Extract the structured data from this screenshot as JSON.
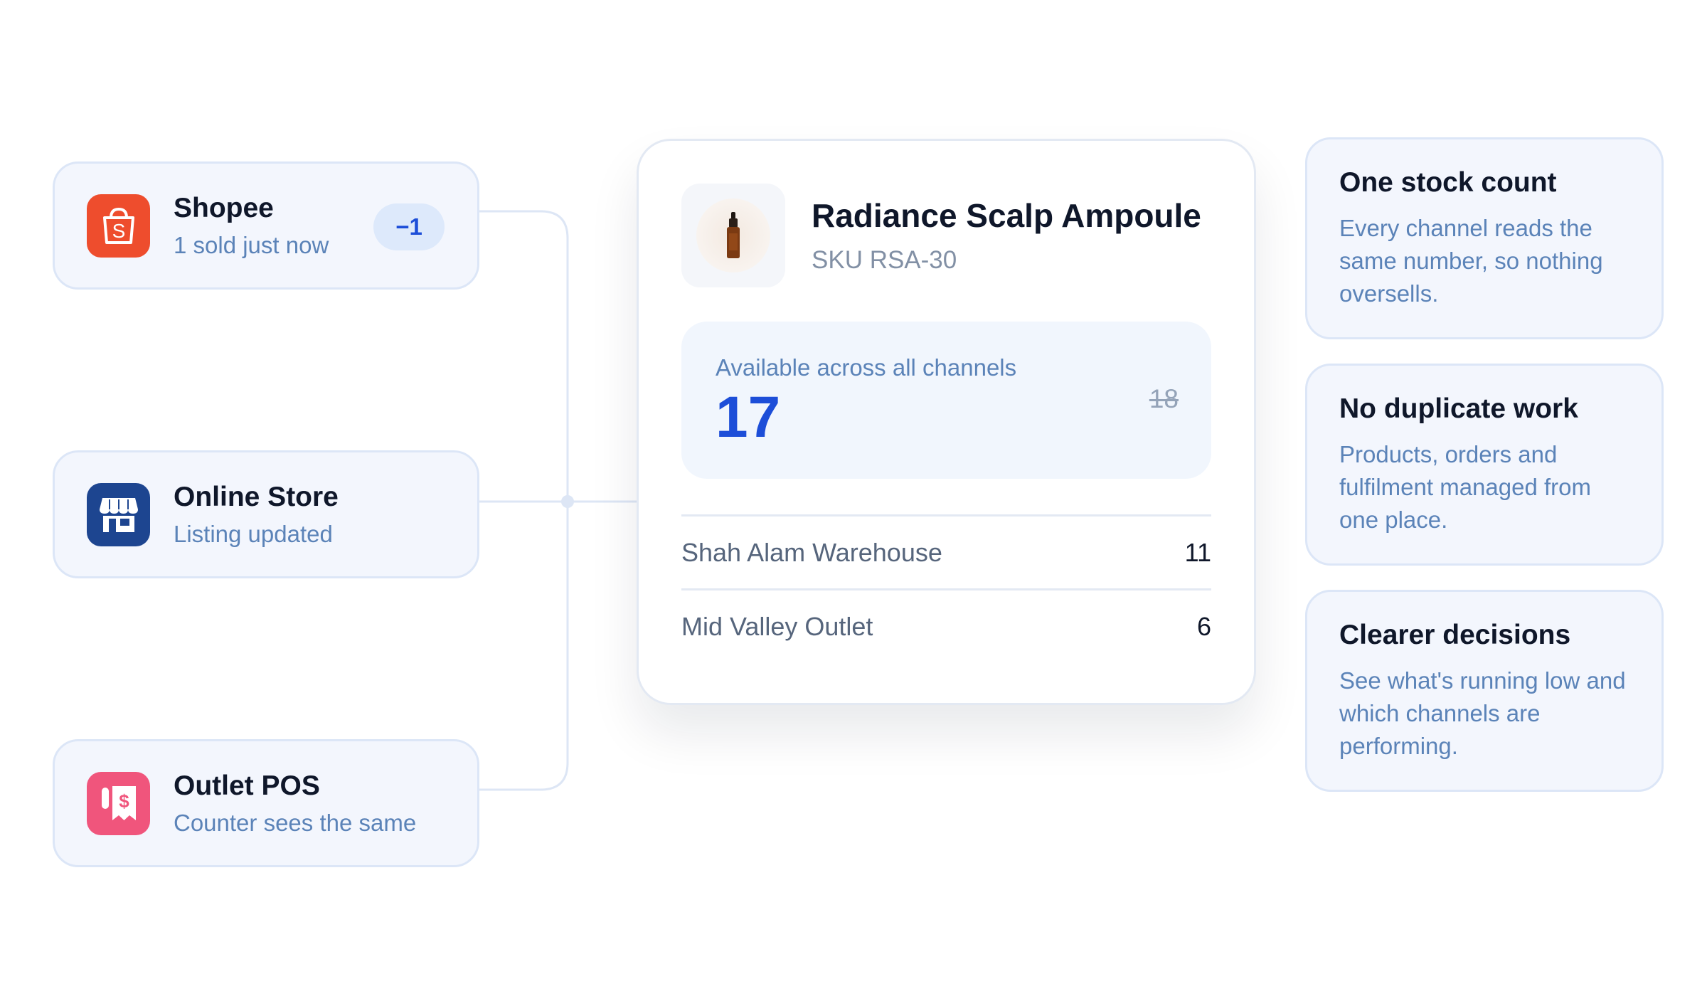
{
  "channels": [
    {
      "name": "Shopee",
      "sub": "1 sold just now",
      "badge": "−1",
      "icon": "shopping-bag-icon",
      "color": "#ee4d2d"
    },
    {
      "name": "Online Store",
      "sub": "Listing updated",
      "icon": "storefront-icon",
      "color": "#1d4590"
    },
    {
      "name": "Outlet POS",
      "sub": "Counter sees the same",
      "icon": "receipt-icon",
      "color": "#f0557c"
    }
  ],
  "product": {
    "title": "Radiance Scalp Ampoule",
    "sku": "SKU RSA-30",
    "thumbnail_icon": "serum-bottle-icon",
    "available_label": "Available across all channels",
    "available_count": "17",
    "previous_count": "18",
    "locations": [
      {
        "name": "Shah Alam Warehouse",
        "qty": "11"
      },
      {
        "name": "Mid Valley Outlet",
        "qty": "6"
      }
    ]
  },
  "benefits": [
    {
      "title": "One stock count",
      "desc": "Every channel reads the same number, so nothing oversells."
    },
    {
      "title": "No duplicate work",
      "desc": "Products, orders and fulfilment managed from one place."
    },
    {
      "title": "Clearer decisions",
      "desc": "See what's running low and which channels are performing."
    }
  ],
  "colors": {
    "accent": "#1d4ed8",
    "muted_blue": "#5b83b8",
    "card_bg": "#f3f6fd",
    "card_border": "#dce6f7"
  }
}
